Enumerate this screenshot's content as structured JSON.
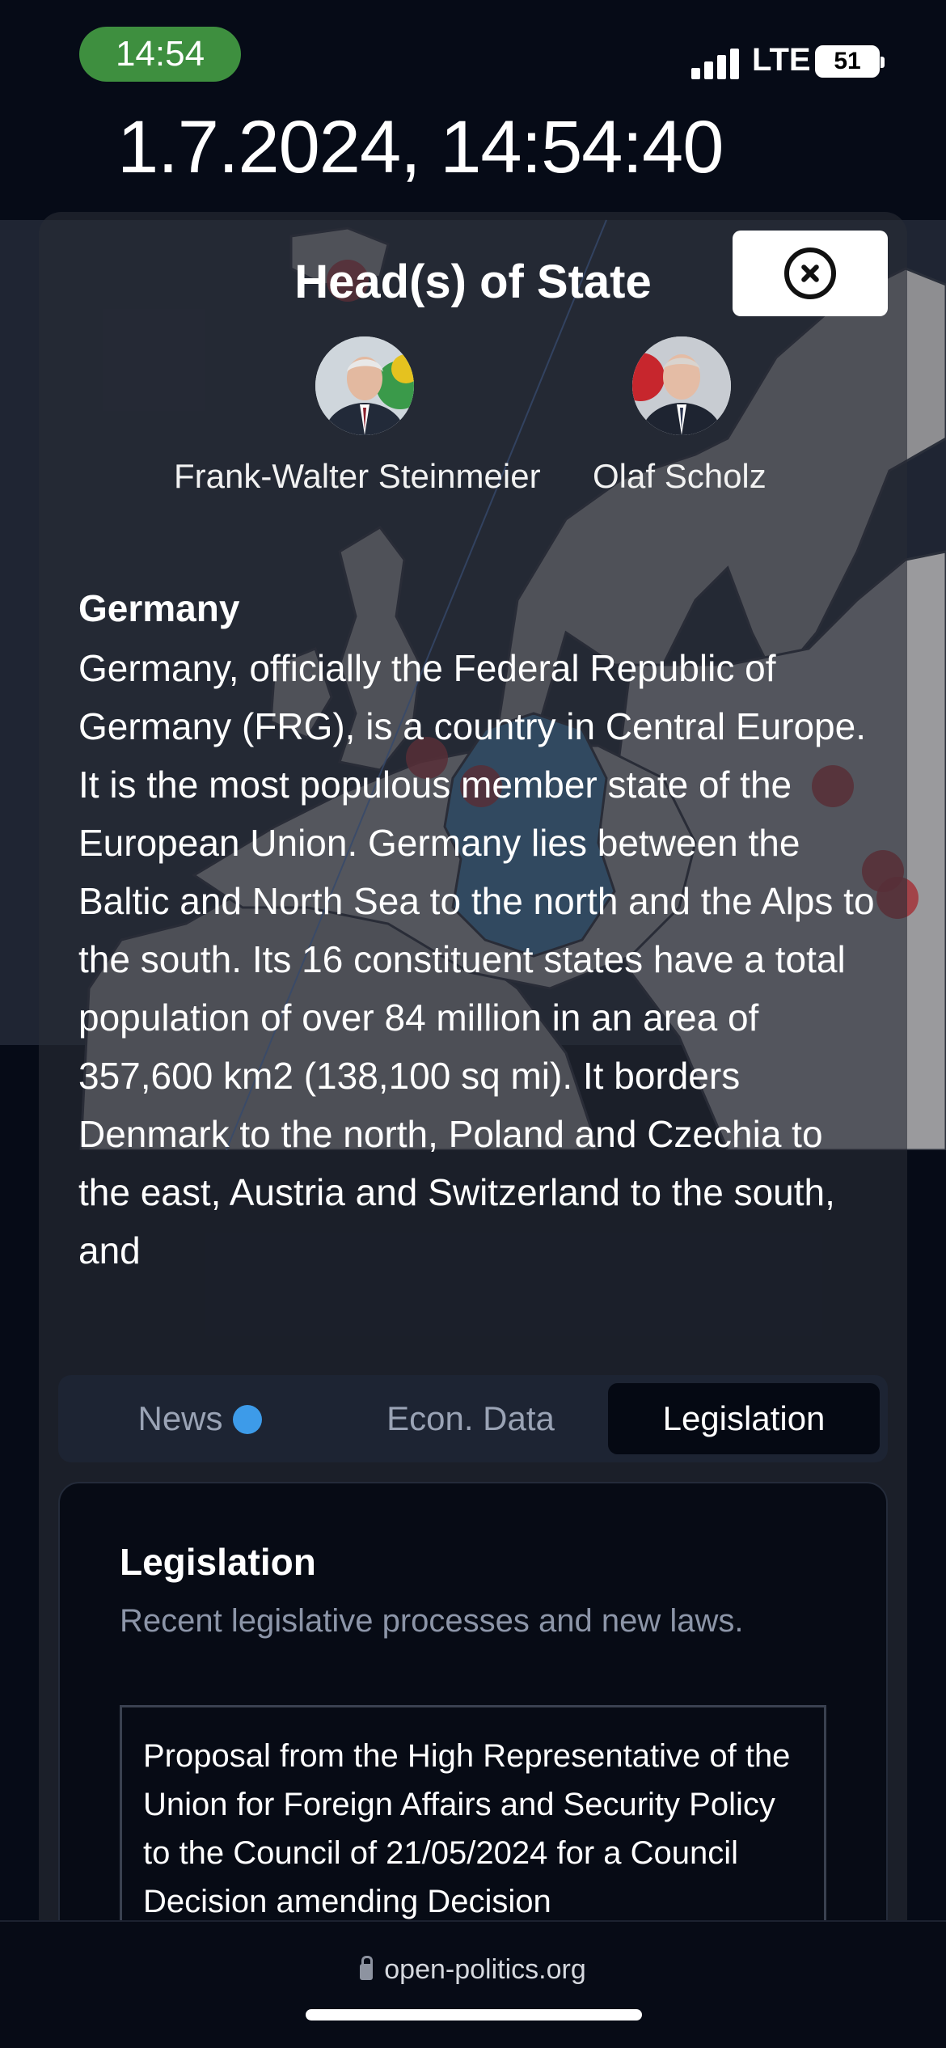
{
  "status_bar": {
    "time": "14:54",
    "network": "LTE",
    "battery": "51"
  },
  "datetime": "1.7.2024, 14:54:40",
  "map": {
    "highlight_country": "Germany",
    "highlight_color": "#3f7aa5",
    "marker_color": "#a3343b"
  },
  "head_of_state": {
    "title": "Head(s) of State",
    "people": [
      {
        "name": "Frank-Walter Steinmeier"
      },
      {
        "name": "Olaf Scholz"
      }
    ],
    "close_icon": "close-circle-icon"
  },
  "country": {
    "name": "Germany",
    "description": "Germany, officially the Federal Republic of Germany (FRG), is a country in Central Europe. It is the most populous member state of the European Union. Germany lies between the Baltic and North Sea to the north and the Alps to the south. Its 16 constituent states have a total population of over 84 million in an area of 357,600 km2 (138,100 sq mi). It borders Denmark to the north, Poland and Czechia to the east, Austria and Switzerland to the south, and"
  },
  "tabs": [
    {
      "label": "News",
      "has_dot": true,
      "dot_color": "#3d9be9"
    },
    {
      "label": "Econ. Data"
    },
    {
      "label": "Legislation",
      "active": true
    }
  ],
  "legislation": {
    "title": "Legislation",
    "subtitle": "Recent legislative processes and new laws.",
    "items": [
      {
        "text": "Proposal from the High Representative of the Union for Foreign Affairs and Security Policy to the Council of 21/05/2024 for a Council Decision amending Decision"
      }
    ]
  },
  "browser": {
    "url": "open-politics.org"
  }
}
